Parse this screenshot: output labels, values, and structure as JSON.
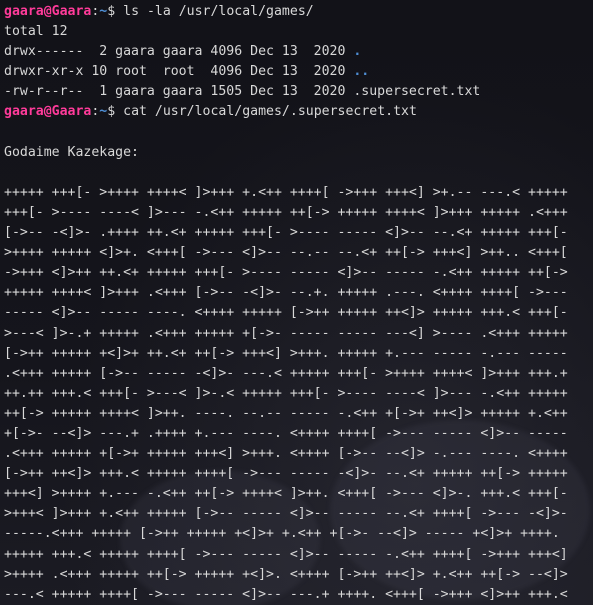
{
  "session": {
    "user_host": "gaara@Gaara",
    "path": "~",
    "prompt_symbol": "$",
    "cmd1": " ls -la /usr/local/games/",
    "cmd2": " cat /usr/local/games/.supersecret.txt"
  },
  "listing": {
    "total": "total 12",
    "rows": [
      {
        "meta": "drwx------  2 gaara gaara 4096 Dec 13  2020 ",
        "name": "."
      },
      {
        "meta": "drwxr-xr-x 10 root  root  4096 Dec 13  2020 ",
        "name": ".."
      },
      {
        "meta": "-rw-r--r--  1 gaara gaara 1505 Dec 13  2020 ",
        "name": ".supersecret.txt"
      }
    ]
  },
  "file": {
    "heading": "Godaime Kazekage:",
    "lines": [
      "+++++ +++[- >++++ ++++< ]>+++ +.<++ ++++[ ->+++ +++<] >+.-- ---.< +++++",
      "+++[- >---- ----< ]>--- -.<++ +++++ ++[-> +++++ ++++< ]>+++ +++++ .<+++",
      "[->-- -<]>- .++++ ++.<+ +++++ +++[- >---- ----- <]>-- --.<+ +++++ +++[-",
      ">++++ +++++ <]>+. <+++[ ->--- <]>-- --.-- --.<+ ++[-> +++<] >++.. <+++[",
      "->+++ <]>++ ++.<+ +++++ +++[- >---- ----- <]>-- ----- -.<++ +++++ ++[->",
      "+++++ ++++< ]>+++ .<+++ [->-- -<]>- --.+. +++++ .---. <++++ ++++[ ->---",
      "----- <]>-- ----- ----. <++++ +++++ [->++ +++++ ++<]> +++++ +++.< +++[-",
      ">---< ]>-.+ +++++ .<+++ +++++ +[->- ----- ----- ---<] >---- .<+++ +++++",
      "[->++ +++++ +<]>+ ++.<+ ++[-> +++<] >+++. +++++ +.--- ----- -.--- -----",
      ".<+++ +++++ [->-- ----- -<]>- ---.< +++++ +++[- >++++ ++++< ]>+++ +++.+",
      "++.++ +++.< +++[- >---< ]>-.< +++++ +++[- >---- ----< ]>--- -.<++ +++++",
      "++[-> +++++ ++++< ]>++. ----. --.-- ----- -.<++ +[->+ ++<]> +++++ +.<++",
      "+[->- --<]> ---.+ .++++ +.--- ----. <++++ ++++[ ->--- ----- <]>-- -----",
      ".<+++ +++++ +[->+ +++++ +++<] >+++. <++++ [->-- --<]> -.--- ----. <++++",
      "[->++ ++<]> +++.< +++++ ++++[ ->--- ----- -<]>- --.<+ +++++ ++[-> +++++",
      "+++<] >++++ +.--- -.<++ ++[-> ++++< ]>++. <+++[ ->--- <]>-. +++.< +++[-",
      ">+++< ]>+++ +.<++ +++++ [->-- ----- <]>-- ----- --.<+ ++++[ ->--- -<]>-",
      "-----.<+++ +++++ [->++ +++++ +<]>+ +.<++ +[->- --<]> ----- +<]>+ ++++.",
      "+++++ +++.< +++++ ++++[ ->--- ----- <]>-- ----- -.<++ ++++[ ->+++ +++<]",
      ">++++ .<+++ +++++ ++[-> +++++ +<]>. <++++ [->++ ++<]> +.<++ ++[-> --<]>",
      "---.< +++++ ++++[ ->--- ----- <]>-- ---.+ ++++. <+++[ ->+++ <]>++ +++.<"
    ]
  }
}
